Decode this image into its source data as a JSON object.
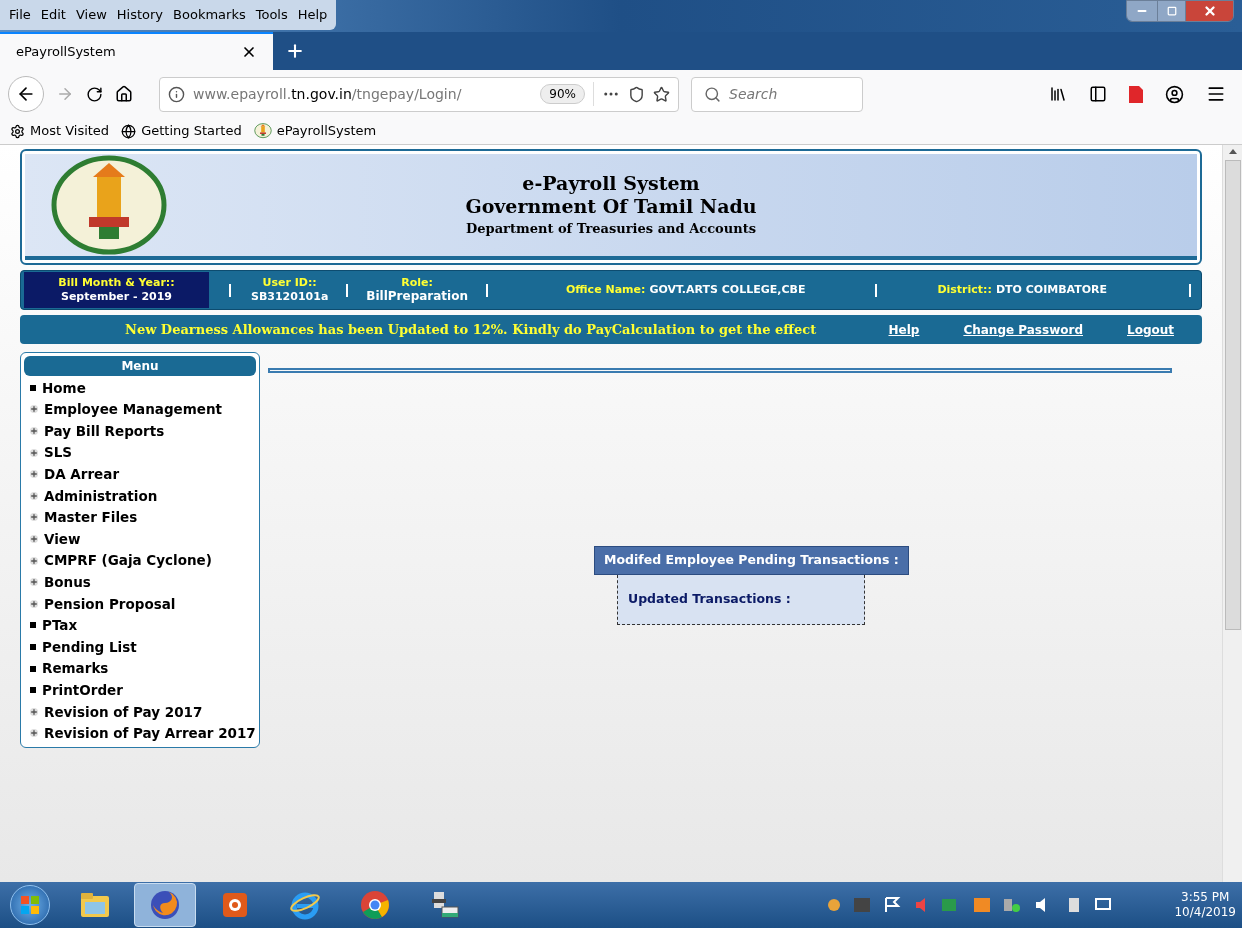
{
  "menu_bar": [
    "File",
    "Edit",
    "View",
    "History",
    "Bookmarks",
    "Tools",
    "Help"
  ],
  "tabs": [
    {
      "label": "ePayrollSystem",
      "selected": true
    }
  ],
  "address_bar": {
    "url_host": "www.epayroll.",
    "url_domain": "tn.gov.in",
    "url_path": "/tngepay/Login/",
    "zoom": "90%"
  },
  "search": {
    "placeholder": "Search"
  },
  "bookmarks": [
    {
      "kind": "gear",
      "label": "Most Visited"
    },
    {
      "kind": "globe",
      "label": "Getting Started"
    },
    {
      "kind": "emblem",
      "label": "ePayrollSystem"
    }
  ],
  "header": {
    "title": "e-Payroll System",
    "subtitle": "Government Of Tamil Nadu",
    "department": "Department of Treasuries and Accounts"
  },
  "info_bar": {
    "bill_label": "Bill Month & Year::",
    "bill_value": "September - 2019",
    "user_label": "User ID::",
    "user_value": "SB3120101a",
    "role_label": "Role:",
    "role_value": "BillPreparation",
    "office_label": "Office Name:",
    "office_value": "GOVT.ARTS COLLEGE,CBE",
    "district_label": "District::",
    "district_value": "DTO COIMBATORE"
  },
  "notice_bar": {
    "message": "New Dearness Allowances has been Updated to 12%. Kindly do PayCalculation to get the effect",
    "links": [
      "Help",
      "Change Password",
      "Logout"
    ]
  },
  "menu": {
    "title": "Menu",
    "items": [
      {
        "label": "Home",
        "kind": "leaf"
      },
      {
        "label": "Employee Management",
        "kind": "expandable"
      },
      {
        "label": "Pay Bill Reports",
        "kind": "expandable"
      },
      {
        "label": "SLS",
        "kind": "expandable"
      },
      {
        "label": "DA Arrear",
        "kind": "expandable"
      },
      {
        "label": "Administration",
        "kind": "expandable"
      },
      {
        "label": "Master Files",
        "kind": "expandable"
      },
      {
        "label": "View",
        "kind": "expandable"
      },
      {
        "label": "CMPRF (Gaja Cyclone)",
        "kind": "expandable"
      },
      {
        "label": "Bonus",
        "kind": "expandable"
      },
      {
        "label": "Pension Proposal",
        "kind": "expandable"
      },
      {
        "label": "PTax",
        "kind": "leaf"
      },
      {
        "label": "Pending List",
        "kind": "leaf"
      },
      {
        "label": "Remarks",
        "kind": "leaf"
      },
      {
        "label": "PrintOrder",
        "kind": "leaf"
      },
      {
        "label": "Revision of Pay 2017",
        "kind": "expandable"
      },
      {
        "label": "Revision of Pay Arrear 2017",
        "kind": "expandable"
      }
    ]
  },
  "pending_panel": {
    "title": "Modifed Employee Pending Transactions :",
    "label": "Updated Transactions :"
  },
  "taskbar": {
    "apps": [
      {
        "kind": "folder",
        "selected": false
      },
      {
        "kind": "firefox",
        "selected": true
      },
      {
        "kind": "player",
        "selected": false
      },
      {
        "kind": "ie",
        "selected": false
      },
      {
        "kind": "chrome",
        "selected": false
      },
      {
        "kind": "devices",
        "selected": false
      }
    ],
    "time": "3:55 PM",
    "date": "10/4/2019"
  }
}
